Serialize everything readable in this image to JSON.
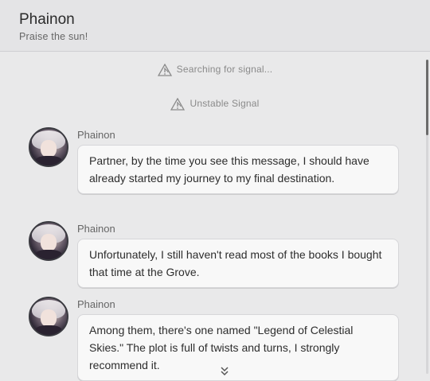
{
  "header": {
    "title": "Phainon",
    "subtitle": "Praise the sun!"
  },
  "system_messages": [
    {
      "text": "Searching for signal...",
      "icon": "signal-icon"
    },
    {
      "text": "Unstable Signal",
      "icon": "signal-icon"
    }
  ],
  "messages": [
    {
      "sender": "Phainon",
      "text": "Partner, by the time you see this message, I should have already started my journey to my final destination."
    },
    {
      "sender": "Phainon",
      "text": "Unfortunately, I still haven't read most of the books I bought that time at the Grove."
    },
    {
      "sender": "Phainon",
      "text": "Among them, there's one named \"Legend of Celestial Skies.\" The plot is full of twists and turns, I strongly recommend it."
    }
  ],
  "icons": {
    "more": "chevron-double-down-icon",
    "avatar": "avatar"
  }
}
